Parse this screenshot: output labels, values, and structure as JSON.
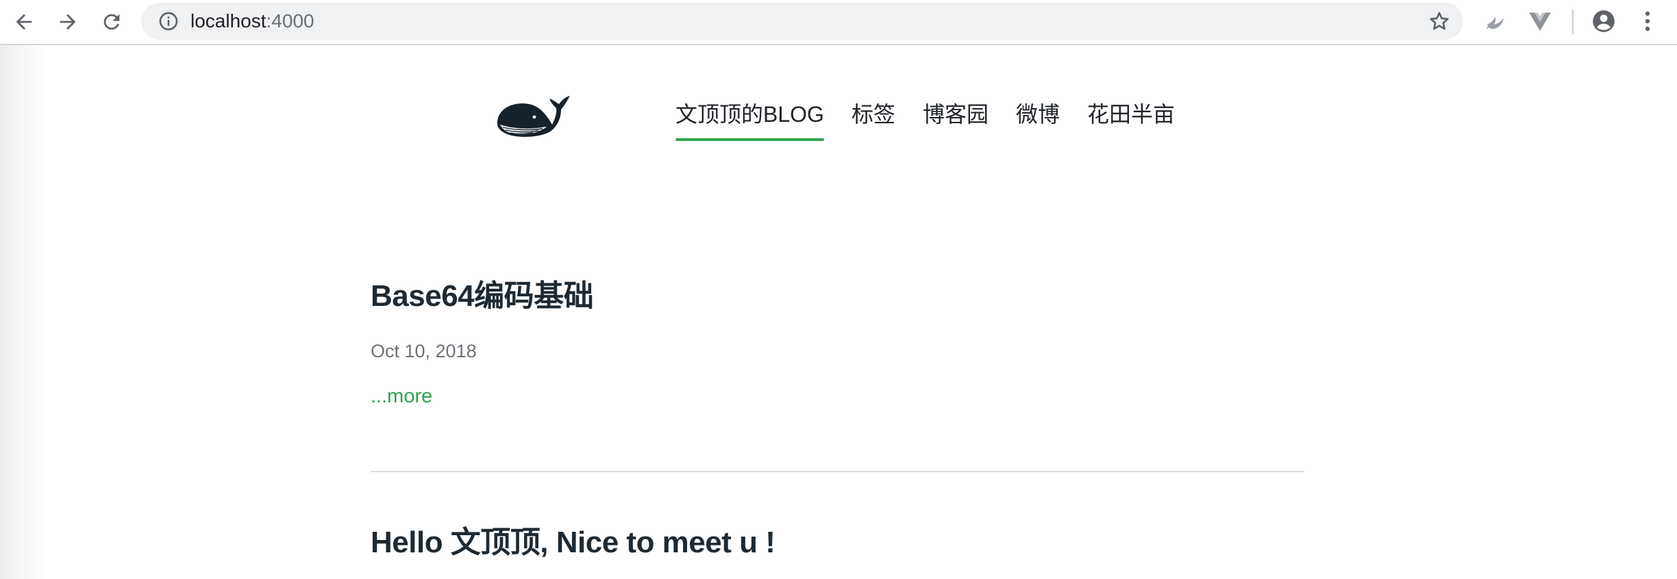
{
  "browser": {
    "url_host": "localhost",
    "url_port": ":4000",
    "icons": {
      "back": "arrow-left-icon",
      "forward": "arrow-right-icon",
      "reload": "reload-icon",
      "site_info": "info-icon",
      "bookmark": "star-icon",
      "extension1": "bird-extension-icon",
      "extension2": "vue-devtools-icon",
      "profile": "account-icon",
      "menu": "kebab-menu-icon"
    }
  },
  "site": {
    "logo": "whale-logo",
    "nav": [
      {
        "label": "文顶顶的BLOG",
        "active": true
      },
      {
        "label": "标签",
        "active": false
      },
      {
        "label": "博客园",
        "active": false
      },
      {
        "label": "微博",
        "active": false
      },
      {
        "label": "花田半亩",
        "active": false
      }
    ],
    "accent_color": "#2ea44f"
  },
  "posts": [
    {
      "title": "Base64编码基础",
      "date": "Oct 10, 2018",
      "more_label": "...more"
    },
    {
      "title": "Hello 文顶顶, Nice to meet u !"
    }
  ]
}
